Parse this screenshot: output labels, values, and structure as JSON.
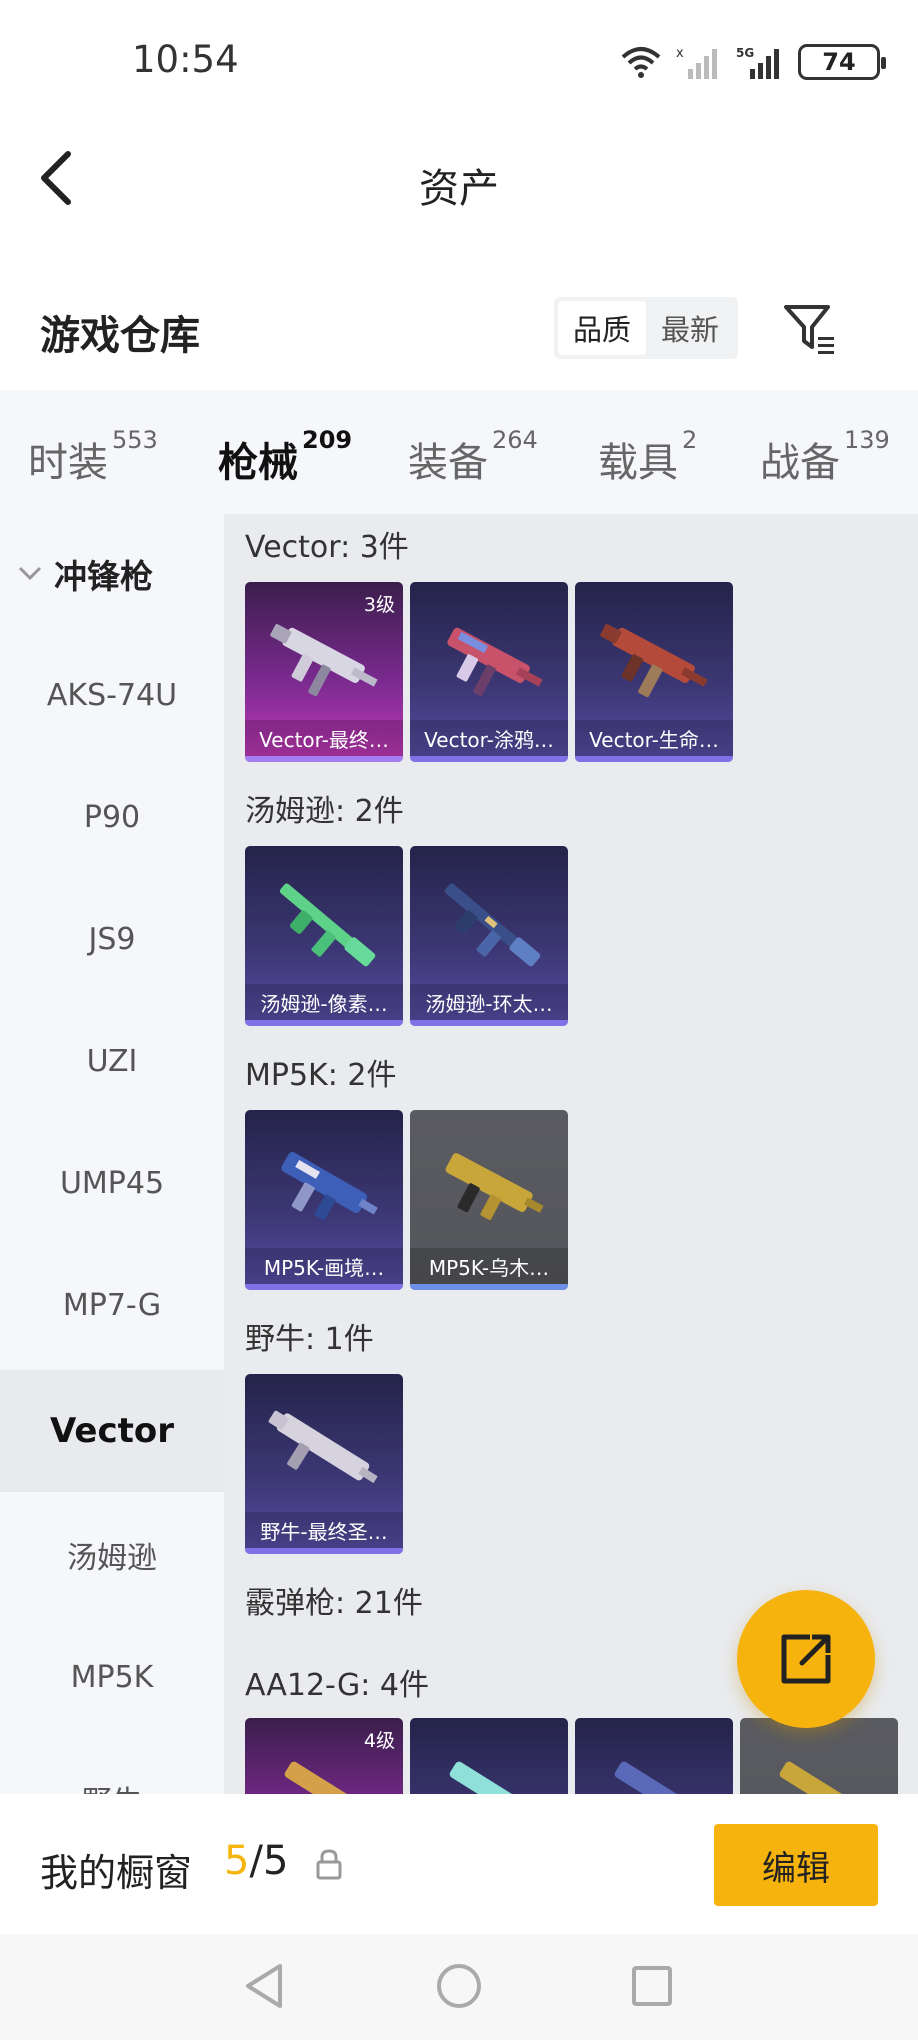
{
  "status_bar": {
    "time": "10:54",
    "battery": "74",
    "network": "5G"
  },
  "header": {
    "title": "资产"
  },
  "warehouse": {
    "title": "游戏仓库",
    "sort_options": [
      "品质",
      "最新"
    ],
    "active_sort": "品质"
  },
  "category_tabs": [
    {
      "label": "时装",
      "count": "553"
    },
    {
      "label": "枪械",
      "count": "209"
    },
    {
      "label": "装备",
      "count": "264"
    },
    {
      "label": "载具",
      "count": "2"
    },
    {
      "label": "战备",
      "count": "139"
    }
  ],
  "sidebar": {
    "group_label": "冲锋枪",
    "items": [
      "AKS-74U",
      "P90",
      "JS9",
      "UZI",
      "UMP45",
      "MP7-G",
      "Vector",
      "汤姆逊",
      "MP5K",
      "野牛"
    ],
    "active_item": "Vector"
  },
  "content": {
    "sections": [
      {
        "title": "Vector: 3件",
        "items": [
          {
            "name": "Vector-最终…",
            "level": "3级",
            "tier": "purple"
          },
          {
            "name": "Vector-涂鸦…",
            "level": "",
            "tier": "blue"
          },
          {
            "name": "Vector-生命…",
            "level": "",
            "tier": "blue"
          }
        ]
      },
      {
        "title": "汤姆逊: 2件",
        "items": [
          {
            "name": "汤姆逊-像素…",
            "level": "",
            "tier": "blue"
          },
          {
            "name": "汤姆逊-环太…",
            "level": "",
            "tier": "blue"
          }
        ]
      },
      {
        "title": "MP5K: 2件",
        "items": [
          {
            "name": "MP5K-画境…",
            "level": "",
            "tier": "blue"
          },
          {
            "name": "MP5K-乌木…",
            "level": "",
            "tier": "gray"
          }
        ]
      },
      {
        "title": "野牛: 1件",
        "items": [
          {
            "name": "野牛-最终圣…",
            "level": "",
            "tier": "blue"
          }
        ]
      }
    ],
    "shotgun_title": "霰弹枪: 21件",
    "aa12_title": "AA12-G: 4件",
    "aa12_level": "4级"
  },
  "showcase": {
    "label": "我的橱窗",
    "current": "5",
    "separator": "/",
    "total": "5",
    "edit_label": "编辑"
  },
  "colors": {
    "accent": "#f7b30d",
    "tab_underline": "#f6b40e"
  }
}
